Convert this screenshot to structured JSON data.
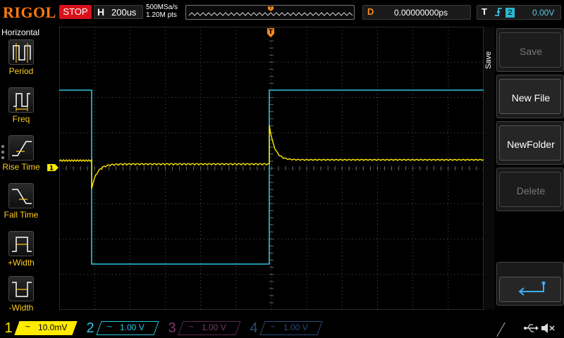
{
  "header": {
    "brand": "RIGOL",
    "run_state": "STOP",
    "horizontal_letter": "H",
    "timebase": "200us",
    "sample_rate": "500MSa/s",
    "memory_depth": "1.20M pts",
    "delay_letter": "D",
    "delay_value": "0.00000000ps",
    "trigger_letter": "T",
    "trigger_edge_icon": "rising-edge-icon",
    "trigger_source": "2",
    "trigger_level": "0.00V"
  },
  "left_menu": {
    "title": "Horizontal",
    "items": [
      {
        "label": "Period",
        "icon": "period-measure-icon"
      },
      {
        "label": "Freq",
        "icon": "frequency-measure-icon"
      },
      {
        "label": "Rise Time",
        "icon": "rise-time-icon"
      },
      {
        "label": "Fall Time",
        "icon": "fall-time-icon"
      },
      {
        "label": "+Width",
        "icon": "positive-width-icon"
      },
      {
        "label": "-Width",
        "icon": "negative-width-icon"
      }
    ]
  },
  "right_menu": {
    "title": "Save",
    "buttons": [
      {
        "label": "Save",
        "enabled": false
      },
      {
        "label": "New File",
        "enabled": true
      },
      {
        "label": "NewFolder",
        "enabled": true
      },
      {
        "label": "Delete",
        "enabled": false
      }
    ],
    "back_icon": "return-arrow-icon"
  },
  "markers": {
    "ch1_marker": "1",
    "trigger_marker": "T"
  },
  "channels": [
    {
      "num": "1",
      "coupling": "~",
      "scale": "10.0mV",
      "active": true,
      "color": "#ffea00"
    },
    {
      "num": "2",
      "coupling": "~",
      "scale": "1.00 V",
      "active": true,
      "color": "#28c8e0"
    },
    {
      "num": "3",
      "coupling": "~",
      "scale": "1.00 V",
      "active": false,
      "color": "#7a3a6a"
    },
    {
      "num": "4",
      "coupling": "~",
      "scale": "1.00 V",
      "active": false,
      "color": "#2a4a7a"
    }
  ],
  "status_icons": [
    "usb-icon",
    "speaker-muted-icon"
  ],
  "colors": {
    "brand": "#ff7a10",
    "stop": "#d8121a",
    "ch1": "#ffea00",
    "ch2": "#28c8e0",
    "trigger": "#ff8a1a"
  }
}
